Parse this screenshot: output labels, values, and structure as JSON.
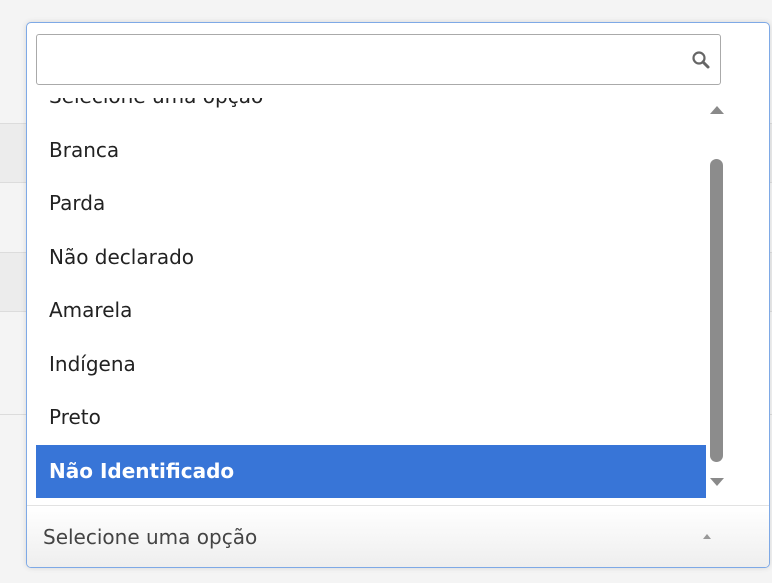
{
  "search": {
    "value": "",
    "placeholder": ""
  },
  "options": [
    "Selecione uma opção",
    "Branca",
    "Parda",
    "Não declarado",
    "Amarela",
    "Indígena",
    "Preto",
    "Não Identificado"
  ],
  "highlighted_option": "Não Identificado",
  "select": {
    "selected_label": "Selecione uma opção"
  },
  "icons": {
    "search": "search-icon",
    "scroll_up": "scroll-up-arrow",
    "scroll_down": "scroll-down-arrow",
    "dropdown_arrow": "caret-up-icon"
  },
  "colors": {
    "highlight": "#3875d7",
    "border": "#7ea9e6"
  }
}
